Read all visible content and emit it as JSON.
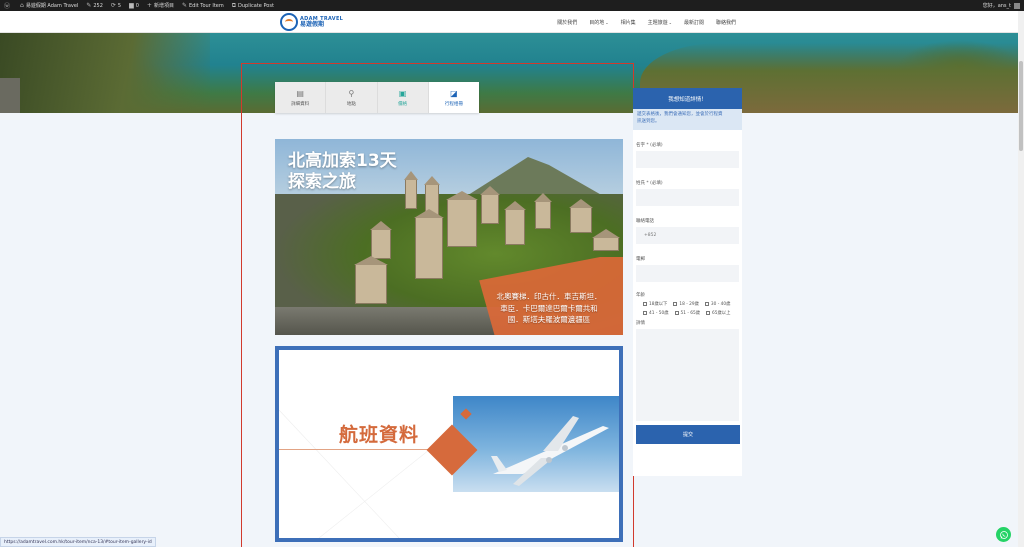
{
  "admin_bar": {
    "site_name": "易遊假期 Adam Travel",
    "visits": "252",
    "updates": "5",
    "comments": "0",
    "new_item": "新增項目",
    "edit_item": "Edit Tour Item",
    "duplicate": "Duplicate Post",
    "greeting": "您好，ans_t"
  },
  "header": {
    "logo_en": "ADAM TRAVEL",
    "logo_zh": "易遊假期",
    "nav": [
      {
        "label": "關於我們",
        "has_menu": false
      },
      {
        "label": "目的地",
        "has_menu": true
      },
      {
        "label": "相片集",
        "has_menu": false
      },
      {
        "label": "主題旅遊",
        "has_menu": true
      },
      {
        "label": "最新訂閱",
        "has_menu": false
      },
      {
        "label": "聯絡我們",
        "has_menu": false
      }
    ]
  },
  "tabs": [
    {
      "label": "詳細資料",
      "icon": "document-icon"
    },
    {
      "label": "地點",
      "icon": "map-pin-icon"
    },
    {
      "label": "價格",
      "icon": "wallet-icon"
    },
    {
      "label": "行程相冊",
      "icon": "gallery-icon"
    }
  ],
  "poster1": {
    "title_line1": "北高加索13天",
    "title_line2": "探索之旅",
    "sub_line1": "北奧賽梯．印古什．車吉斯坦．",
    "sub_line2": "車臣．卡巴爾達巴爾卡爾共和",
    "sub_line3": "國．斯塔夫羅波爾邊疆區"
  },
  "poster2": {
    "title": "航班資料"
  },
  "enquiry": {
    "title": "我想知道詳情！",
    "note_line1": "遞交表格後，我們會通知您，並會於行程資",
    "note_line2": "訊送到您。",
    "name_label": "名字 * (必填)",
    "surname_label": "姓氏 * (必填)",
    "phone_label": "聯絡電話",
    "phone_value": "+852",
    "email_label": "電郵",
    "age_label": "年齡",
    "age_options": [
      "18歲以下",
      "18 - 29歲",
      "30 - 40歲",
      "41 - 50歲",
      "51 - 65歲",
      "65歲以上"
    ],
    "message_label": "詳情",
    "submit": "提交"
  },
  "status_url": "https://adamtravel.com.hk/tour-item/nca-13/#tour-item-gallery-id",
  "colors": {
    "brand_blue": "#2b63ae",
    "accent_orange": "#d66a3c",
    "tab_green": "#26a69a",
    "outline_red": "#d13a2d"
  }
}
